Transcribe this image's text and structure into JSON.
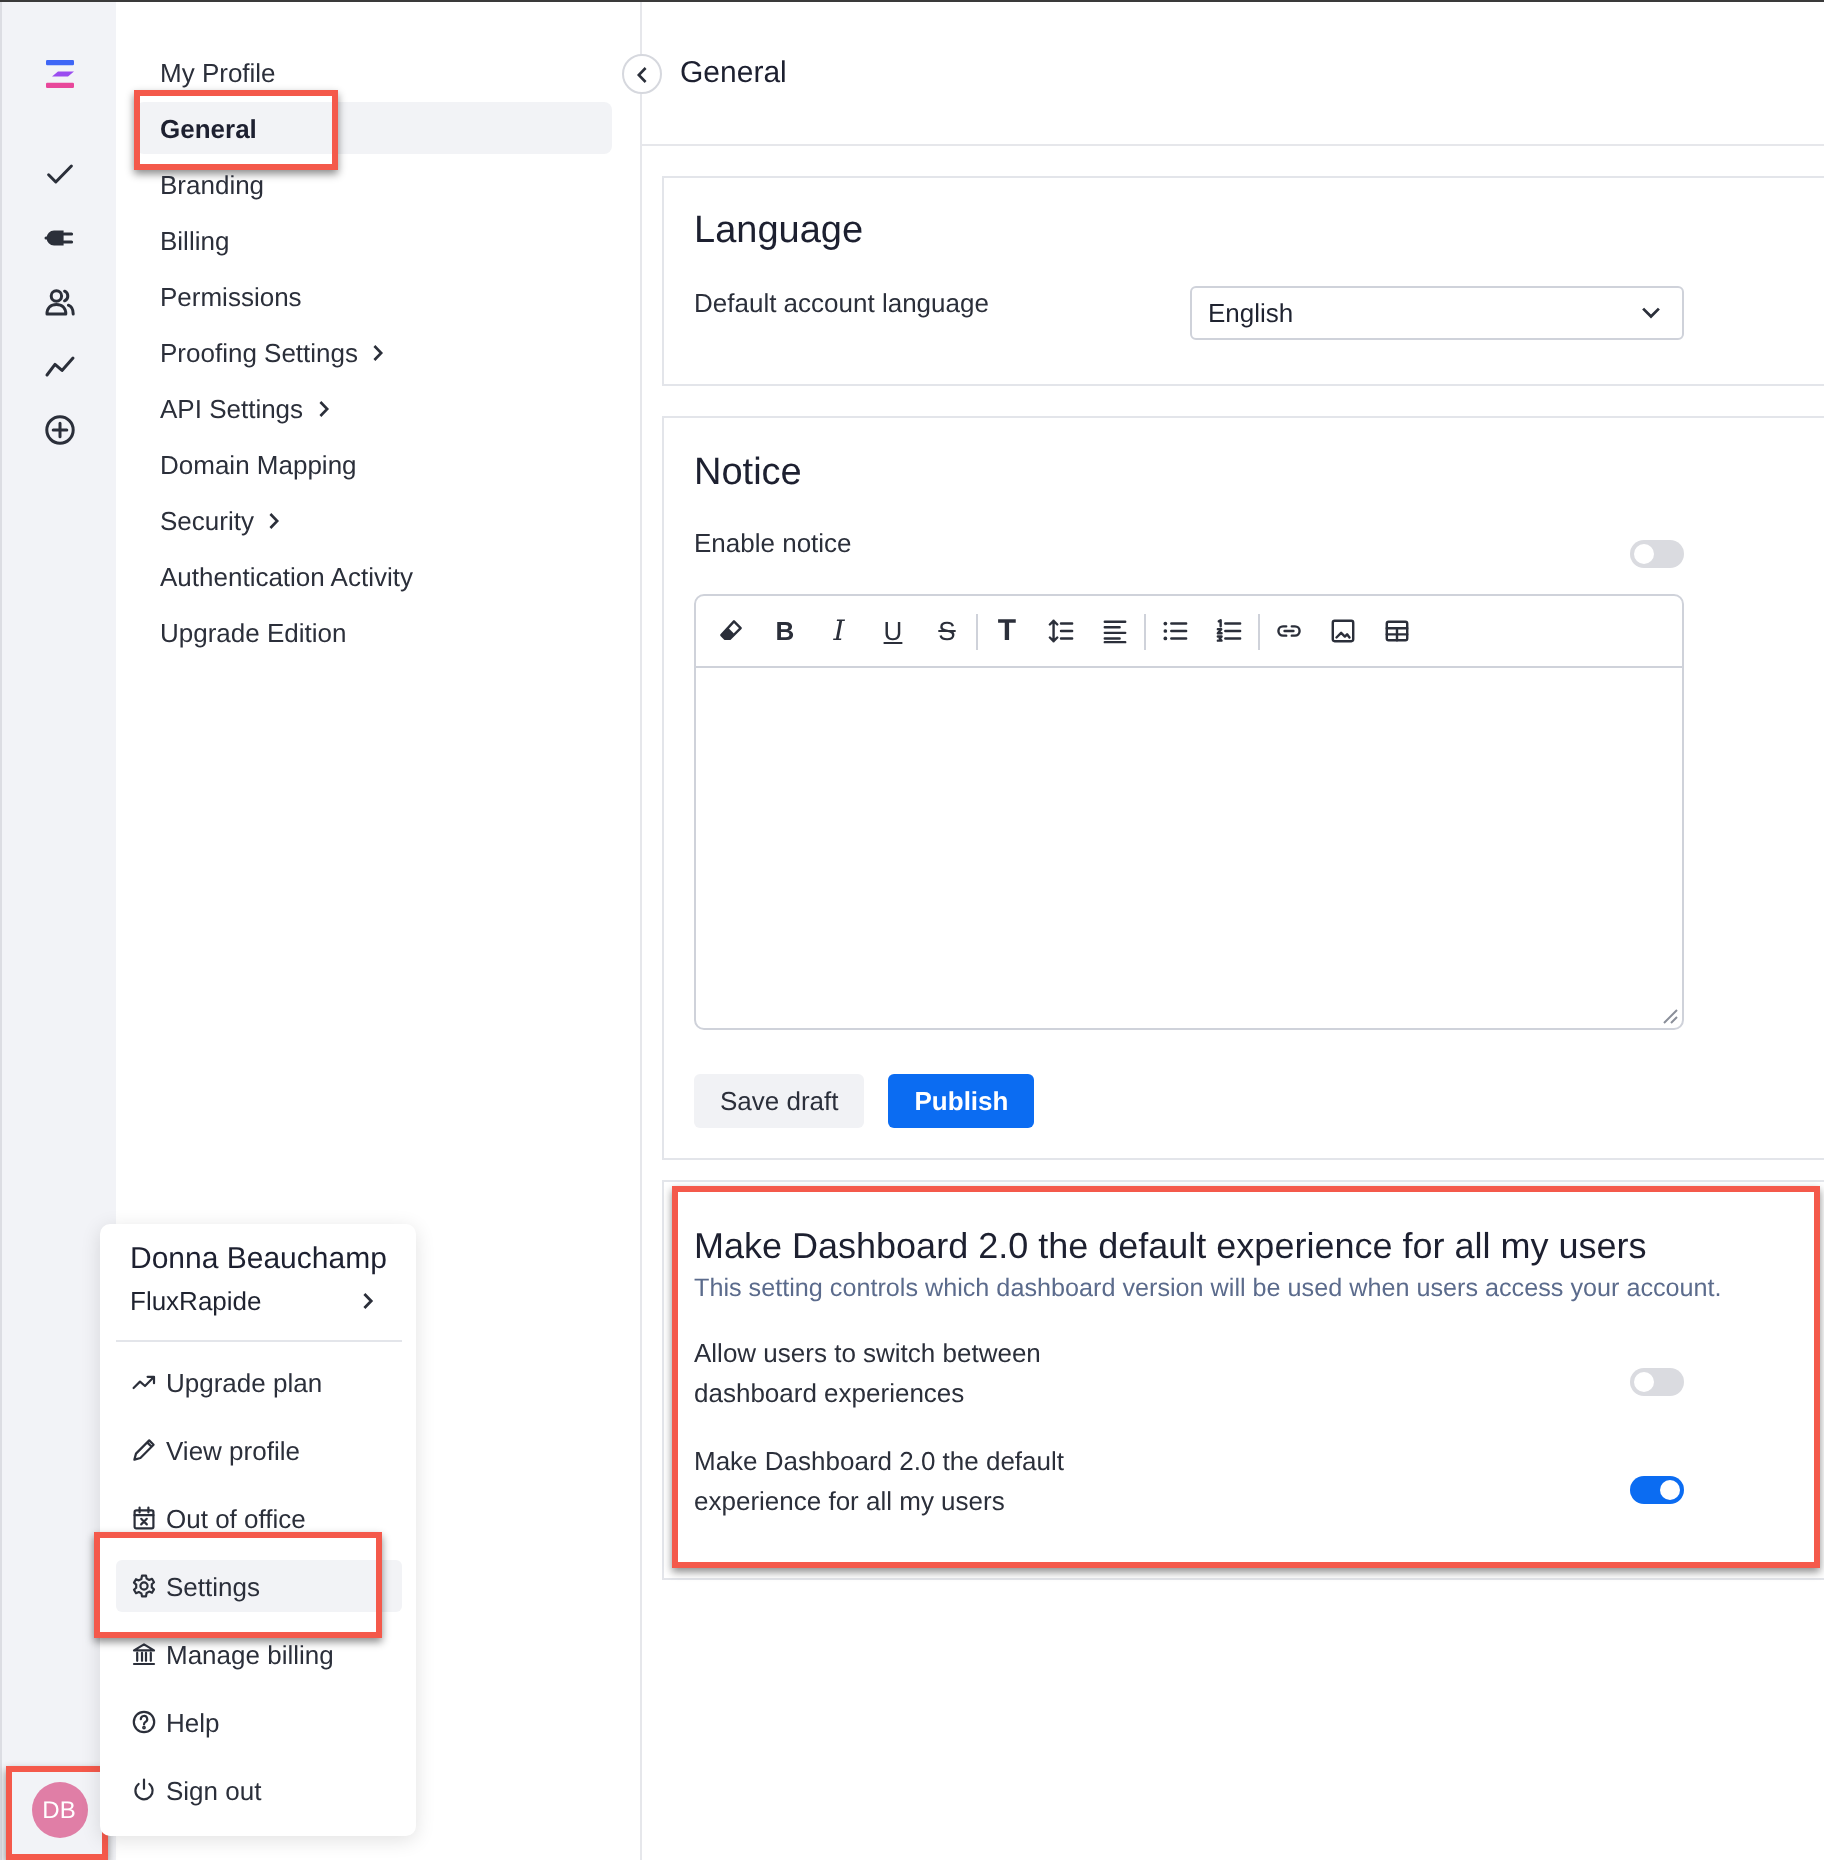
{
  "rail": {
    "avatar": {
      "initials": "DB",
      "highlighted": true
    }
  },
  "settings_nav": {
    "items": [
      {
        "label": "My Profile",
        "selected": false,
        "has_submenu": false,
        "highlighted": false
      },
      {
        "label": "General",
        "selected": true,
        "has_submenu": false,
        "highlighted": true
      },
      {
        "label": "Branding",
        "selected": false,
        "has_submenu": false,
        "highlighted": false
      },
      {
        "label": "Billing",
        "selected": false,
        "has_submenu": false,
        "highlighted": false
      },
      {
        "label": "Permissions",
        "selected": false,
        "has_submenu": false,
        "highlighted": false
      },
      {
        "label": "Proofing Settings",
        "selected": false,
        "has_submenu": true,
        "highlighted": false
      },
      {
        "label": "API Settings",
        "selected": false,
        "has_submenu": true,
        "highlighted": false
      },
      {
        "label": "Domain Mapping",
        "selected": false,
        "has_submenu": false,
        "highlighted": false
      },
      {
        "label": "Security",
        "selected": false,
        "has_submenu": true,
        "highlighted": false
      },
      {
        "label": "Authentication Activity",
        "selected": false,
        "has_submenu": false,
        "highlighted": false
      },
      {
        "label": "Upgrade Edition",
        "selected": false,
        "has_submenu": false,
        "highlighted": false
      }
    ]
  },
  "header": {
    "title": "General"
  },
  "language_card": {
    "title": "Language",
    "field_label": "Default account language",
    "select_value": "English"
  },
  "notice_card": {
    "title": "Notice",
    "toggle_label": "Enable notice",
    "on": false,
    "toolbar_groups": [
      {
        "tools": [
          {
            "kind": "eraser"
          },
          {
            "kind": "bold",
            "label": "B"
          },
          {
            "kind": "italic",
            "label": "I"
          },
          {
            "kind": "underline",
            "label": "U"
          },
          {
            "kind": "strike",
            "label": "S"
          }
        ]
      },
      {
        "tools": [
          {
            "kind": "text",
            "label": "T"
          },
          {
            "kind": "line-height"
          },
          {
            "kind": "align"
          }
        ]
      },
      {
        "tools": [
          {
            "kind": "bullets"
          },
          {
            "kind": "numbers"
          }
        ]
      },
      {
        "tools": [
          {
            "kind": "link"
          },
          {
            "kind": "image"
          },
          {
            "kind": "table"
          }
        ]
      }
    ],
    "buttons": [
      {
        "label": "Save draft",
        "kind": "secondary"
      },
      {
        "label": "Publish",
        "kind": "primary"
      }
    ]
  },
  "dashboard_card": {
    "title": "Make Dashboard 2.0 the default experience for all my users",
    "description": "This setting controls which dashboard version will be used when users access your account.",
    "highlighted": true,
    "settings": [
      {
        "label": "Allow users to switch between dashboard experiences",
        "on": false
      },
      {
        "label": "Make Dashboard 2.0 the default experience for all my users",
        "on": true
      }
    ]
  },
  "account_menu": {
    "name": "Donna Beauchamp",
    "organization": "FluxRapide",
    "items": [
      {
        "label": "Upgrade plan",
        "selected": false,
        "highlighted": false
      },
      {
        "label": "View profile",
        "selected": false,
        "highlighted": false
      },
      {
        "label": "Out of office",
        "selected": false,
        "highlighted": false
      },
      {
        "label": "Settings",
        "selected": true,
        "highlighted": true
      },
      {
        "label": "Manage billing",
        "selected": false,
        "highlighted": false
      },
      {
        "label": "Help",
        "selected": false,
        "highlighted": false
      },
      {
        "label": "Sign out",
        "selected": false,
        "highlighted": false
      }
    ]
  }
}
